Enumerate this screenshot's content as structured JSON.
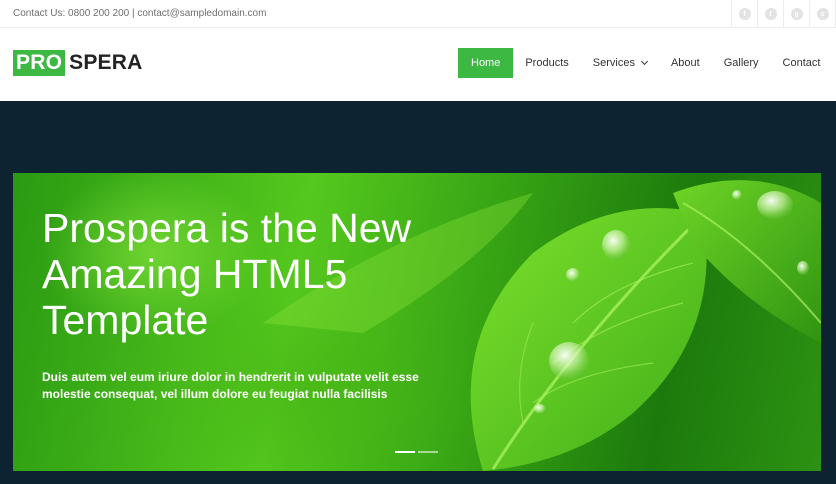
{
  "topbar": {
    "contact_text": "Contact Us: 0800 200 200 | contact@sampledomain.com",
    "social": [
      {
        "icon": "facebook-icon",
        "glyph": "f"
      },
      {
        "icon": "twitter-icon",
        "glyph": "t"
      },
      {
        "icon": "google-plus-icon",
        "glyph": "g"
      },
      {
        "icon": "skype-icon",
        "glyph": "s"
      }
    ]
  },
  "header": {
    "logo": {
      "part1": "PRO",
      "part2": "SPERA"
    },
    "nav": [
      {
        "label": "Home",
        "active": true
      },
      {
        "label": "Products"
      },
      {
        "label": "Services",
        "dropdown": true
      },
      {
        "label": "About"
      },
      {
        "label": "Gallery"
      },
      {
        "label": "Contact"
      }
    ]
  },
  "hero": {
    "title": "Prospera is the New Amazing HTML5 Template",
    "text": "Duis autem vel eum iriure dolor in hendrerit in vulputate velit esse molestie consequat, vel illum dolore eu feugiat nulla facilisis",
    "slides_count": 2,
    "active_slide": 0
  },
  "colors": {
    "accent": "#3cb843",
    "hero_bg": "#0e2332",
    "text_dark": "#333333"
  }
}
